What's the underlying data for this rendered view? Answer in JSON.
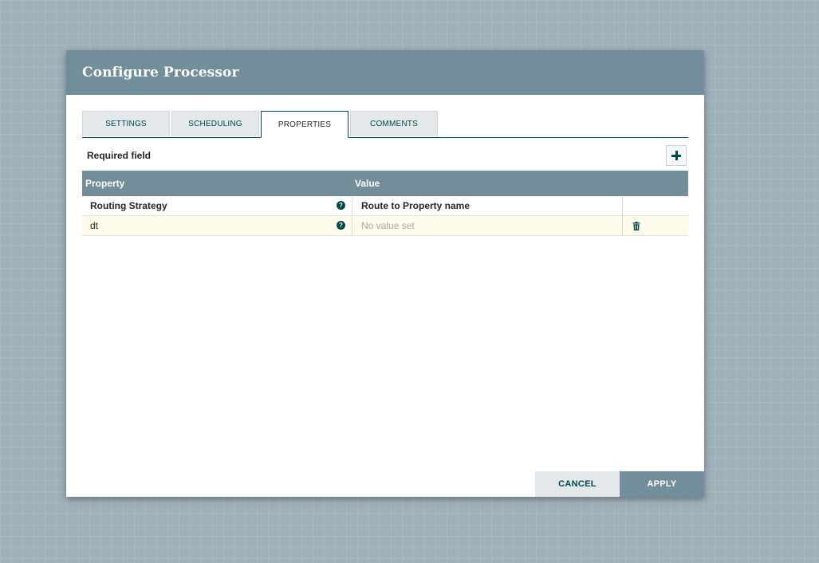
{
  "dialog": {
    "title": "Configure Processor"
  },
  "tabs": [
    {
      "label": "SETTINGS",
      "active": false
    },
    {
      "label": "SCHEDULING",
      "active": false
    },
    {
      "label": "PROPERTIES",
      "active": true
    },
    {
      "label": "COMMENTS",
      "active": false
    }
  ],
  "properties": {
    "required_label": "Required field",
    "add_icon": "plus-icon",
    "columns": [
      "Property",
      "Value"
    ],
    "rows": [
      {
        "property": "Routing Strategy",
        "value": "Route to Property name",
        "required": true,
        "value_set": true,
        "deletable": false,
        "selected": false
      },
      {
        "property": "dt",
        "value": "No value set",
        "required": false,
        "value_set": false,
        "deletable": true,
        "selected": true
      }
    ],
    "help_icon_glyph": "?"
  },
  "footer": {
    "cancel_label": "CANCEL",
    "apply_label": "APPLY"
  },
  "colors": {
    "header_bg": "#728e9b",
    "accent": "#004849",
    "canvas_bg": "#9eb0ba",
    "selected_row_bg": "#fffbeb"
  }
}
